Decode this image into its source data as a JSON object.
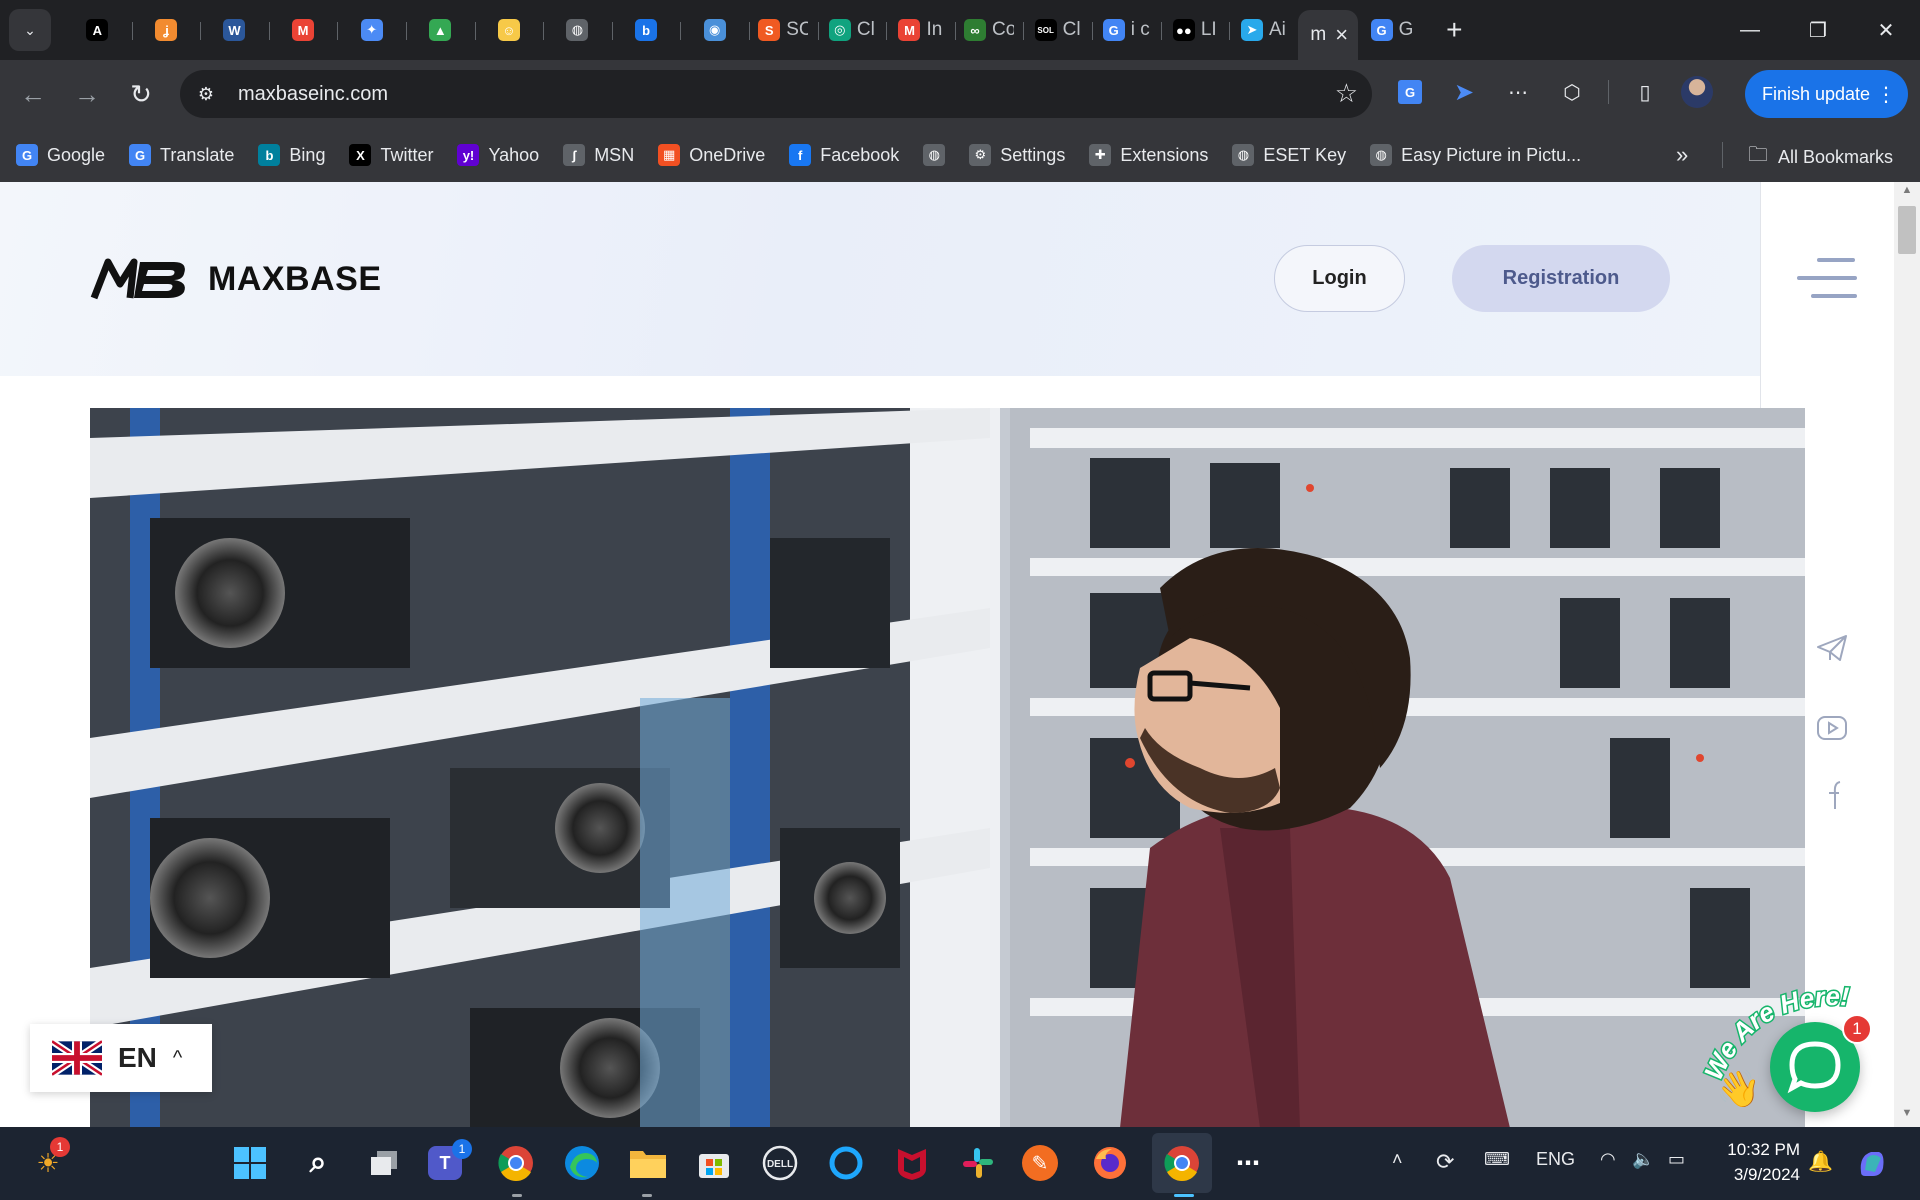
{
  "browser": {
    "tabs": [
      {
        "icon": "A",
        "label": "",
        "color": "#000000"
      },
      {
        "icon": "ʝ",
        "label": "",
        "color": "#f28b30"
      },
      {
        "icon": "W",
        "label": "",
        "color": "#2b579a"
      },
      {
        "icon": "M",
        "label": "",
        "color": "#ea4335"
      },
      {
        "icon": "✦",
        "label": "",
        "color": "#4c8bf5"
      },
      {
        "icon": "▲",
        "label": "",
        "color": "#34a853"
      },
      {
        "icon": "☺",
        "label": "",
        "color": "#f7c948"
      },
      {
        "icon": "◍",
        "label": "",
        "color": "#5f6368"
      },
      {
        "icon": "b",
        "label": "",
        "color": "#1a73e8"
      },
      {
        "icon": "◉",
        "label": "",
        "color": "#4a90d9"
      },
      {
        "icon": "S",
        "label": "SC",
        "color": "#f05a22"
      },
      {
        "icon": "◎",
        "label": "Cl",
        "color": "#10a37f"
      },
      {
        "icon": "M",
        "label": "In",
        "color": "#ea4335"
      },
      {
        "icon": "∞",
        "label": "Co",
        "color": "#2e7d32"
      },
      {
        "icon": "SOL",
        "label": "Cl",
        "color": "#000000"
      },
      {
        "icon": "G",
        "label": "i c",
        "color": "#4285f4"
      },
      {
        "icon": "●●",
        "label": "LI",
        "color": "#000000"
      },
      {
        "icon": "➤",
        "label": "Ai",
        "color": "#29a9eb"
      },
      {
        "icon": "m",
        "label": "",
        "color": "#35363a",
        "active": true
      },
      {
        "icon": "G",
        "label": "G",
        "color": "#4285f4"
      }
    ],
    "url": "maxbaseinc.com",
    "finish_update": "Finish update",
    "bookmarks": [
      {
        "icon": "G",
        "label": "Google",
        "color": "#4285f4"
      },
      {
        "icon": "G",
        "label": "Translate",
        "color": "#4285f4"
      },
      {
        "icon": "b",
        "label": "Bing",
        "color": "#00809d"
      },
      {
        "icon": "X",
        "label": "Twitter",
        "color": "#000000"
      },
      {
        "icon": "y!",
        "label": "Yahoo",
        "color": "#6001d2"
      },
      {
        "icon": "ʃ",
        "label": "MSN",
        "color": "#5f6368"
      },
      {
        "icon": "▦",
        "label": "OneDrive",
        "color": "#f25022"
      },
      {
        "icon": "f",
        "label": "Facebook",
        "color": "#1877f2"
      },
      {
        "icon": "◍",
        "label": "",
        "color": "#5f6368"
      },
      {
        "icon": "⚙",
        "label": "Settings",
        "color": "#5f6368"
      },
      {
        "icon": "✚",
        "label": "Extensions",
        "color": "#5f6368"
      },
      {
        "icon": "◍",
        "label": "ESET Key",
        "color": "#5f6368"
      },
      {
        "icon": "◍",
        "label": "Easy Picture in Pictu...",
        "color": "#5f6368"
      }
    ],
    "all_bookmarks": "All Bookmarks"
  },
  "site": {
    "logo_mark": "MB",
    "logo_text": "MAXBASE",
    "login": "Login",
    "registration": "Registration",
    "language": "EN",
    "chat_tagline": "We Are Here!",
    "chat_badge": "1"
  },
  "taskbar": {
    "weather_badge": "1",
    "teams_badge": "1",
    "lang": "ENG",
    "time": "10:32 PM",
    "date": "3/9/2024"
  }
}
